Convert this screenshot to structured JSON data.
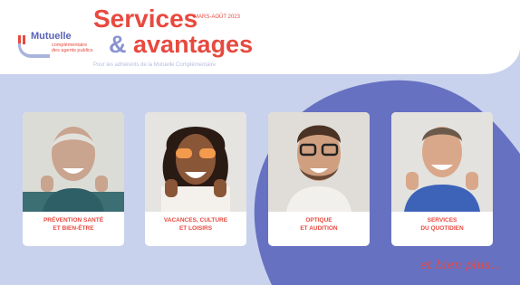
{
  "logo": {
    "name": "Mutuelle",
    "sub_line1": "complémentaire",
    "sub_line2": "des agents publics"
  },
  "header": {
    "title_line1": "Services",
    "title_amp": "&",
    "title_line2": "avantages",
    "date": "MARS-AOÛT 2023",
    "tagline": "Pour les adhérents de la Mutuelle Complémentaire"
  },
  "cards": [
    {
      "line1": "PRÉVENTION SANTÉ",
      "line2": "ET BIEN-ÊTRE"
    },
    {
      "line1": "VACANCES, CULTURE",
      "line2": "ET LOISIRS"
    },
    {
      "line1": "OPTIQUE",
      "line2": "ET AUDITION"
    },
    {
      "line1": "SERVICES",
      "line2": "DU QUOTIDIEN"
    }
  ],
  "footer": {
    "more": "et bien plus..."
  },
  "colors": {
    "accent": "#e8493f",
    "brand": "#5a63b7",
    "background": "#c9d2ec",
    "blob": "#6671c2"
  }
}
